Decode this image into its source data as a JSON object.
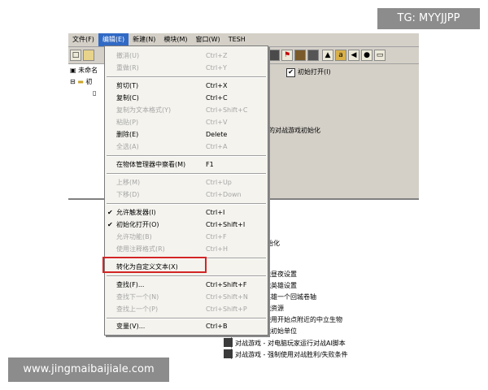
{
  "menubar": {
    "items": [
      "文件(F)",
      "编辑(E)",
      "新建(N)",
      "模块(M)",
      "窗口(W)",
      "TESH"
    ]
  },
  "tree": {
    "root": "未命名",
    "child": "初"
  },
  "right": {
    "checkbox_label": "初始打开(I)",
    "checkbox_checked": "✔",
    "top_description": "认的对战游戏初始化"
  },
  "panel": {
    "init_text": "始化",
    "actions": [
      "戏 - 使用对战昼夜设置",
      "戏 - 使用对战英雄设置",
      "戏 - 给首发英雄一个回城卷轴",
      "戏 - 设置对战资源",
      "戏 - 删除已使用开始点附近的中立生物",
      "戏 - 创建对战初始单位",
      "对战游戏 - 对电脑玩家运行对战AI脚本",
      "对战游戏 - 强制使用对战胜利/失败条件"
    ]
  },
  "edit_menu": {
    "items": [
      {
        "label": "撤消(U)",
        "shortcut": "Ctrl+Z"
      },
      {
        "label": "重做(R)",
        "shortcut": "Ctrl+Y"
      },
      {
        "label": "剪切(T)",
        "shortcut": "Ctrl+X"
      },
      {
        "label": "复制(C)",
        "shortcut": "Ctrl+C"
      },
      {
        "label": "复制为文本格式(Y)",
        "shortcut": "Ctrl+Shift+C"
      },
      {
        "label": "粘贴(P)",
        "shortcut": "Ctrl+V"
      },
      {
        "label": "删除(E)",
        "shortcut": "Delete"
      },
      {
        "label": "全选(A)",
        "shortcut": "Ctrl+A"
      },
      {
        "label": "在物体管理器中察看(M)",
        "shortcut": "F1"
      },
      {
        "label": "上移(M)",
        "shortcut": "Ctrl+Up"
      },
      {
        "label": "下移(D)",
        "shortcut": "Ctrl+Down"
      },
      {
        "label": "允许触发器(I)",
        "shortcut": "Ctrl+I",
        "check": "✔"
      },
      {
        "label": "初始化打开(O)",
        "shortcut": "Ctrl+Shift+I",
        "check": "✔"
      },
      {
        "label": "允许功能(B)",
        "shortcut": "Ctrl+F"
      },
      {
        "label": "使用注释格式(R)",
        "shortcut": "Ctrl+H"
      },
      {
        "label": "转化为自定义文本(X)",
        "shortcut": ""
      },
      {
        "label": "查找(F)...",
        "shortcut": "Ctrl+Shift+F"
      },
      {
        "label": "查找下一个(N)",
        "shortcut": "Ctrl+Shift+N"
      },
      {
        "label": "查找上一个(P)",
        "shortcut": "Ctrl+Shift+P"
      },
      {
        "label": "变量(V)...",
        "shortcut": "Ctrl+B"
      }
    ]
  },
  "watermarks": {
    "tg": "TG: MYYJJPP",
    "site": "www.jingmaibaijiale.com"
  },
  "colors": {
    "menu_highlight": "#316ac5",
    "box_highlight": "#d32525",
    "window_bg": "#d4d0c8"
  }
}
